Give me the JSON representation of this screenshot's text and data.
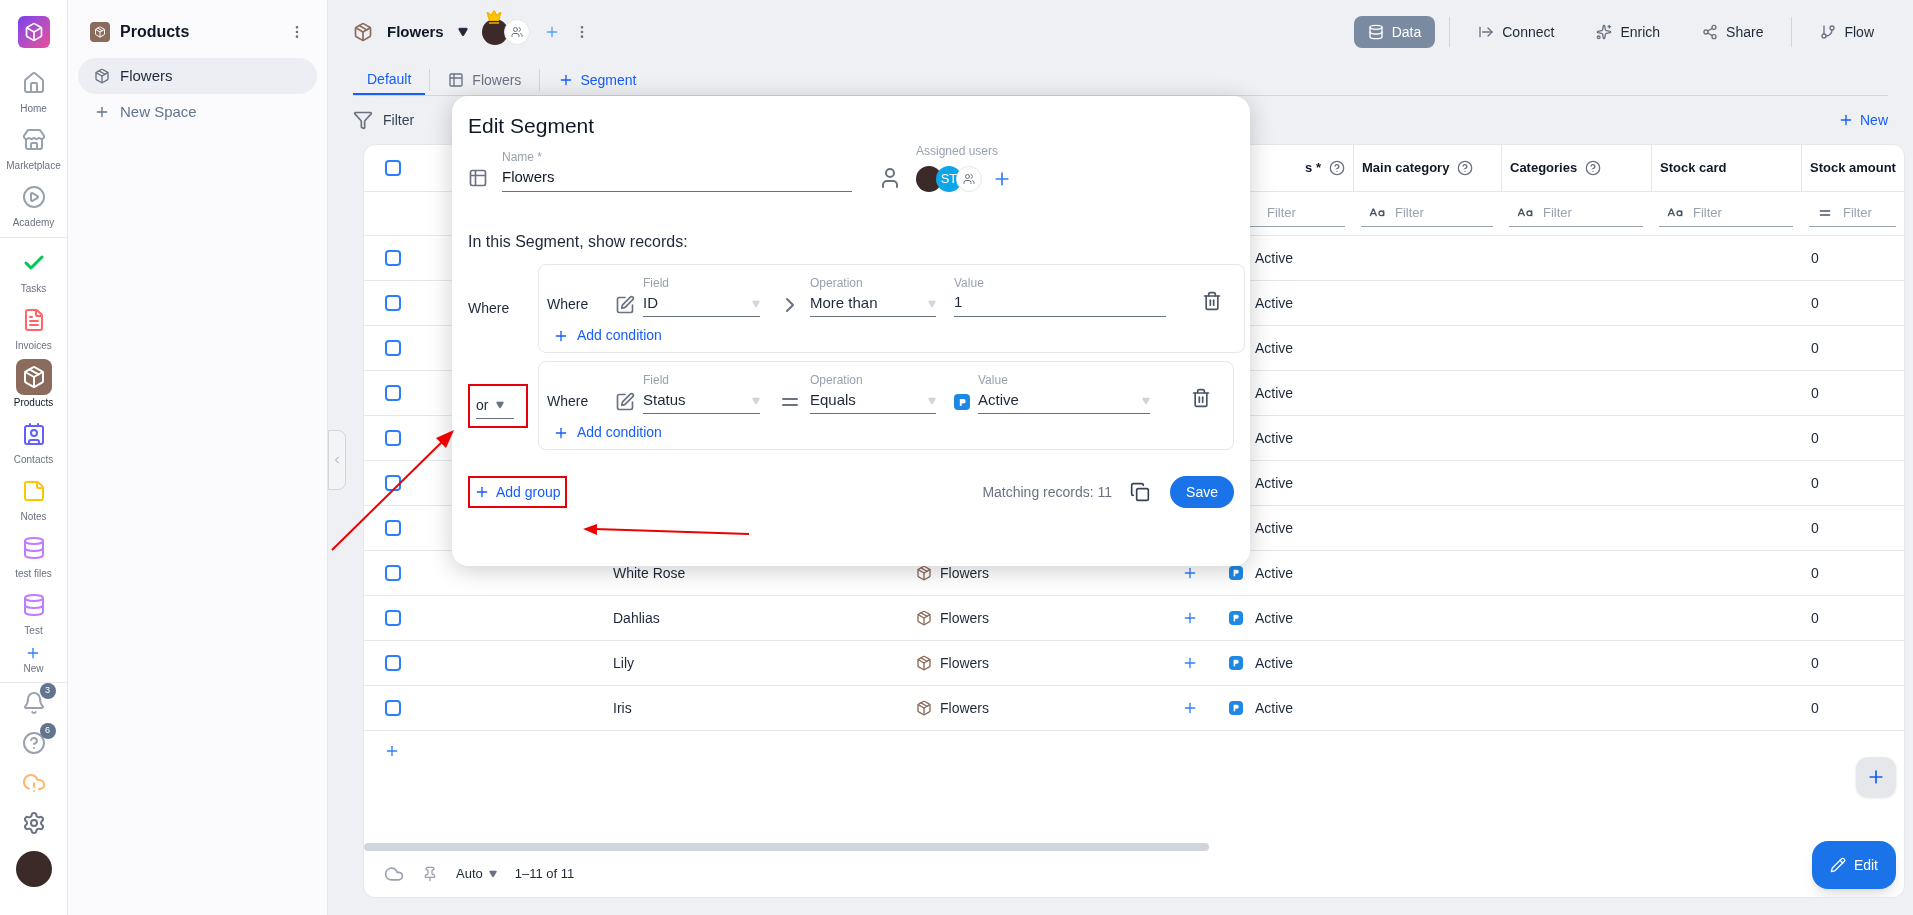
{
  "rail": {
    "items": [
      {
        "label": "Home",
        "kind": "home",
        "selected": false
      },
      {
        "label": "Marketplace",
        "kind": "store",
        "selected": false
      },
      {
        "label": "Academy",
        "kind": "play",
        "selected": false
      },
      {
        "label": "Tasks",
        "kind": "check",
        "selected": false
      },
      {
        "label": "Invoices",
        "kind": "invoice",
        "selected": false
      },
      {
        "label": "Products",
        "kind": "box",
        "selected": true
      },
      {
        "label": "Contacts",
        "kind": "contact",
        "selected": false
      },
      {
        "label": "Notes",
        "kind": "note",
        "selected": false
      },
      {
        "label": "test files",
        "kind": "db",
        "selected": false
      },
      {
        "label": "Test",
        "kind": "db",
        "selected": false
      }
    ],
    "new_label": "New",
    "notifications_badge": "3",
    "help_badge": "6"
  },
  "sidebar": {
    "title": "Products",
    "items": [
      {
        "label": "Flowers",
        "selected": true
      }
    ],
    "new_space": "New Space"
  },
  "header": {
    "title": "Flowers",
    "actions": [
      {
        "label": "Data",
        "selected": true
      },
      {
        "label": "Connect",
        "selected": false
      },
      {
        "label": "Enrich",
        "selected": false
      },
      {
        "label": "Share",
        "selected": false
      },
      {
        "label": "Flow",
        "selected": false
      }
    ]
  },
  "tabs": [
    {
      "label": "Default",
      "selected": true,
      "kind": "plain"
    },
    {
      "label": "Flowers",
      "selected": false,
      "kind": "table"
    }
  ],
  "add_segment": "Segment",
  "toolbar": {
    "filter": "Filter",
    "new": "New"
  },
  "table": {
    "header_checked": false,
    "columns": [
      {
        "label": "s *",
        "help": true,
        "filter": "Filter"
      },
      {
        "label": "Main category",
        "help": true,
        "filter": "Filter",
        "kind": "text"
      },
      {
        "label": "Categories",
        "help": true,
        "filter": "Filter",
        "kind": "text"
      },
      {
        "label": "Stock card",
        "help": false,
        "filter": "Filter",
        "kind": "text"
      },
      {
        "label": "Stock amount",
        "help": false,
        "filter": "Filter",
        "kind": "number"
      }
    ],
    "rows": [
      {
        "checked": false,
        "status": "Active",
        "amount": "0"
      },
      {
        "checked": false,
        "status": "Active",
        "amount": "0"
      },
      {
        "checked": false,
        "status": "Active",
        "amount": "0"
      },
      {
        "checked": false,
        "status": "Active",
        "amount": "0"
      },
      {
        "checked": false,
        "status": "Active",
        "amount": "0"
      },
      {
        "checked": false,
        "status": "Active",
        "amount": "0"
      },
      {
        "checked": false,
        "status": "Active",
        "amount": "0"
      },
      {
        "checked": false,
        "name": "White Rose",
        "space": "Flowers",
        "status": "Active",
        "amount": "0"
      },
      {
        "checked": false,
        "name": "Dahlias",
        "space": "Flowers",
        "status": "Active",
        "amount": "0"
      },
      {
        "checked": false,
        "name": "Lily",
        "space": "Flowers",
        "status": "Active",
        "amount": "0"
      },
      {
        "checked": false,
        "name": "Iris",
        "space": "Flowers",
        "status": "Active",
        "amount": "0"
      }
    ]
  },
  "footer": {
    "row_height": "Auto",
    "range": "1–11 of 11",
    "edit": "Edit"
  },
  "modal": {
    "title": "Edit Segment",
    "name_label": "Name *",
    "name_value": "Flowers",
    "assigned_label": "Assigned users",
    "assigned_initials": "ST",
    "intro": "In this Segment, show records:",
    "groups": [
      {
        "connector": {
          "kind": "label",
          "text": "Where"
        },
        "highlighted": false,
        "add_condition": "Add condition",
        "conditions": [
          {
            "where": "Where",
            "field_label": "Field",
            "field": "ID",
            "op_label": "Operation",
            "op": {
              "kind": "gt",
              "text": "More than"
            },
            "value_label": "Value",
            "value": {
              "kind": "text",
              "text": "1"
            }
          }
        ]
      },
      {
        "connector": {
          "kind": "select",
          "text": "or"
        },
        "highlighted": true,
        "add_condition": "Add condition",
        "conditions": [
          {
            "where": "Where",
            "field_label": "Field",
            "field": "Status",
            "op_label": "Operation",
            "op": {
              "kind": "eq",
              "text": "Equals"
            },
            "value_label": "Value",
            "value": {
              "kind": "option",
              "text": "Active"
            }
          }
        ]
      }
    ],
    "add_group": "Add group",
    "add_group_highlighted": true,
    "matching": "Matching records: 11",
    "save": "Save"
  }
}
